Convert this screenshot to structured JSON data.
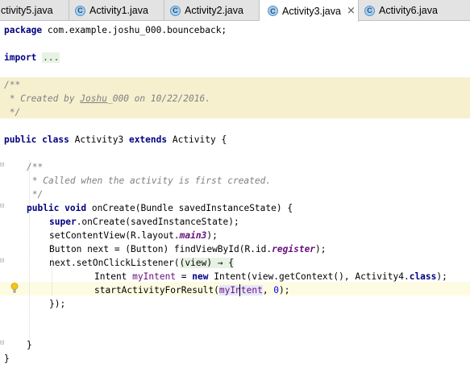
{
  "tabs": [
    {
      "label": "ctivity5.java",
      "icon": "class-c-icon",
      "closable": false,
      "active": false
    },
    {
      "label": "Activity1.java",
      "icon": "class-c-icon",
      "closable": false,
      "active": false
    },
    {
      "label": "Activity2.java",
      "icon": "class-c-icon",
      "closable": false,
      "active": false
    },
    {
      "label": "Activity3.java",
      "icon": "class-c-icon",
      "closable": true,
      "close_glyph": "×",
      "active": true
    },
    {
      "label": "Activity6.java",
      "icon": "class-c-icon",
      "closable": false,
      "active": false
    }
  ],
  "tab_icon_letter": "C",
  "code": {
    "l1": {
      "kw": "package",
      "rest": " com.example.joshu_000.bounceback;"
    },
    "l2": {
      "kw": "import",
      "fold": "..."
    },
    "l3": {
      "text": "/**"
    },
    "l4": {
      "pre": " * Created by ",
      "user": "Joshu",
      "post": "_000 on 10/22/2016."
    },
    "l5": {
      "text": " */"
    },
    "l6": {
      "kw1": "public",
      "kw2": "class",
      "name": " Activity3 ",
      "kw3": "extends",
      "rest": " Activity {"
    },
    "l7": {
      "text": "/**"
    },
    "l8": {
      "text": " * Called when the activity is first created."
    },
    "l9": {
      "text": " */"
    },
    "l10": {
      "kw1": "public",
      "kw2": "void",
      "rest": " onCreate(Bundle savedInstanceState) {"
    },
    "l11": {
      "kw": "super",
      "rest": ".onCreate(savedInstanceState);"
    },
    "l12": {
      "pre": "setContentView(R.layout.",
      "field": "main3",
      "post": ");"
    },
    "l13": {
      "pre": "Button next = (Button) findViewById(R.id.",
      "field": "register",
      "post": ");"
    },
    "l14": {
      "pre": "next.setOnClickListener(",
      "lam": "(view) → {"
    },
    "l15": {
      "pre": "Intent ",
      "var": "myIntent",
      "mid": " = ",
      "kw": "new",
      "post1": " Intent(view.getContext(), Activity4.",
      "kw2": "class",
      "post2": ");"
    },
    "l16": {
      "pre": "startActivityForResult(",
      "var": "myIntent",
      "mid": ", ",
      "num": "0",
      "post": ");"
    },
    "l17": {
      "text": "});"
    },
    "l18": {
      "text": "}"
    },
    "l19": {
      "text": "}"
    }
  }
}
